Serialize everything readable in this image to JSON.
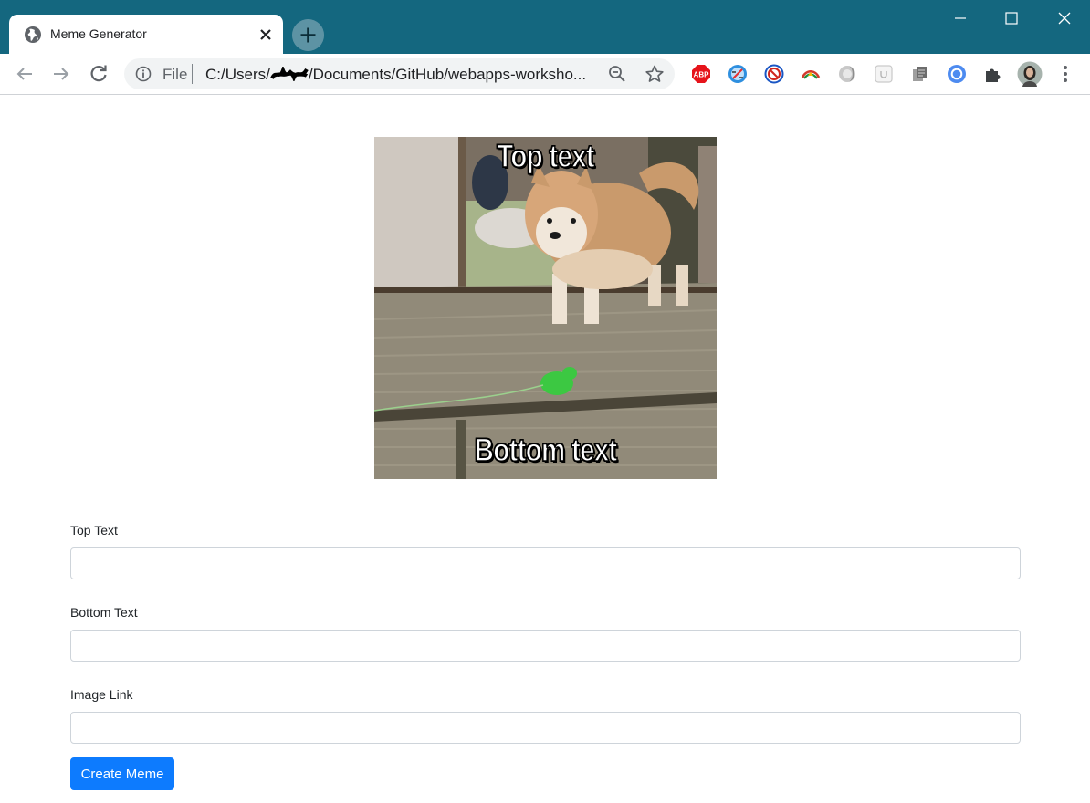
{
  "browser": {
    "tab_title": "Meme Generator",
    "url_scheme": "File",
    "url_prefix": "C:/Users/",
    "url_suffix": "/Documents/GitHub/webapps-worksho...",
    "frame_color": "#14677f",
    "extensions": [
      "abp-icon",
      "safari-share-icon",
      "block-icon",
      "arc-icon",
      "half-moon-icon",
      "clipboard-icon",
      "copy-icon",
      "circle-ring-icon",
      "puzzle-icon"
    ]
  },
  "meme": {
    "top_text": "Top text",
    "bottom_text": "Bottom text",
    "image_description_icon": "dog-photo"
  },
  "form": {
    "top_label": "Top Text",
    "top_value": "",
    "bottom_label": "Bottom Text",
    "bottom_value": "",
    "image_label": "Image Link",
    "image_value": "",
    "submit_label": "Create Meme",
    "accent_color": "#0d7bfe"
  },
  "extension_badges": {
    "abp": "ABP"
  }
}
